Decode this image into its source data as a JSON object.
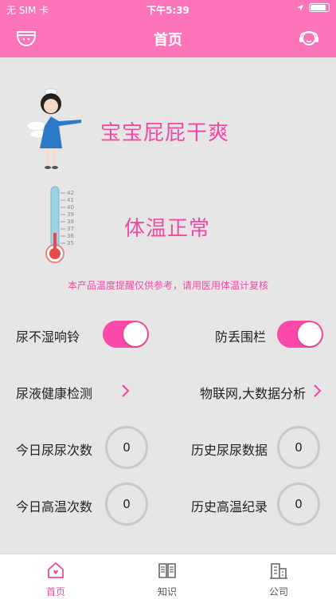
{
  "status_bar": {
    "carrier": "无 SIM 卡",
    "time": "下午5:39"
  },
  "nav": {
    "title": "首页",
    "left_icon": "diaper-icon",
    "right_icon": "headset-support-icon"
  },
  "main": {
    "dry_status": "宝宝屁屁干爽",
    "temp_status": "体温正常",
    "thermometer_scale": [
      "42",
      "41",
      "40",
      "39",
      "38",
      "37",
      "36",
      "35"
    ],
    "disclaimer": "本产品温度提醒仅供参考，请用医用体温计复核"
  },
  "settings": {
    "wet_alarm_label": "尿不湿响铃",
    "wet_alarm_on": true,
    "geofence_label": "防丢围栏",
    "geofence_on": true,
    "urine_test_label": "尿液健康检测",
    "iot_label": "物联网,大数据分析"
  },
  "stats": {
    "today_urine_label": "今日尿尿次数",
    "today_urine_value": "0",
    "history_urine_label": "历史尿尿数据",
    "history_urine_value": "0",
    "today_hightemp_label": "今日高温次数",
    "today_hightemp_value": "0",
    "history_hightemp_label": "历史高温纪录",
    "history_hightemp_value": "0"
  },
  "tabs": [
    {
      "label": "首页",
      "icon": "home-heart-icon",
      "active": true
    },
    {
      "label": "知识",
      "icon": "book-icon",
      "active": false
    },
    {
      "label": "公司",
      "icon": "building-icon",
      "active": false
    }
  ],
  "colors": {
    "brand_pink": "#fd74b8",
    "accent_pink": "#f04aa3",
    "background": "#e6e6e6"
  }
}
